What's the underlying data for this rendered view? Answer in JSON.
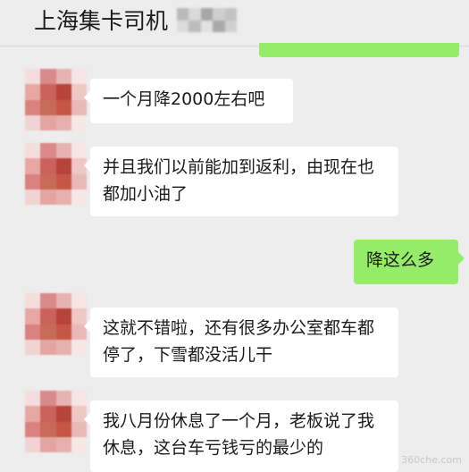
{
  "header": {
    "title": "上海集卡司机"
  },
  "messages": [
    {
      "side": "left",
      "text": "一个月降2000左右吧"
    },
    {
      "side": "left",
      "text": "并且我们以前能加到返利，由现在也都加小油了"
    },
    {
      "side": "right",
      "text": "降这么多"
    },
    {
      "side": "left",
      "text": "这就不错啦，还有很多办公室都车都停了，下雪都没活儿干"
    },
    {
      "side": "left",
      "text": "我八月份休息了一个月，老板说了我休息，这台车亏钱亏的最少的"
    }
  ],
  "watermark": "360che.com",
  "colors": {
    "background": "#ededed",
    "sent_bubble": "#95ec69",
    "received_bubble": "#ffffff"
  }
}
